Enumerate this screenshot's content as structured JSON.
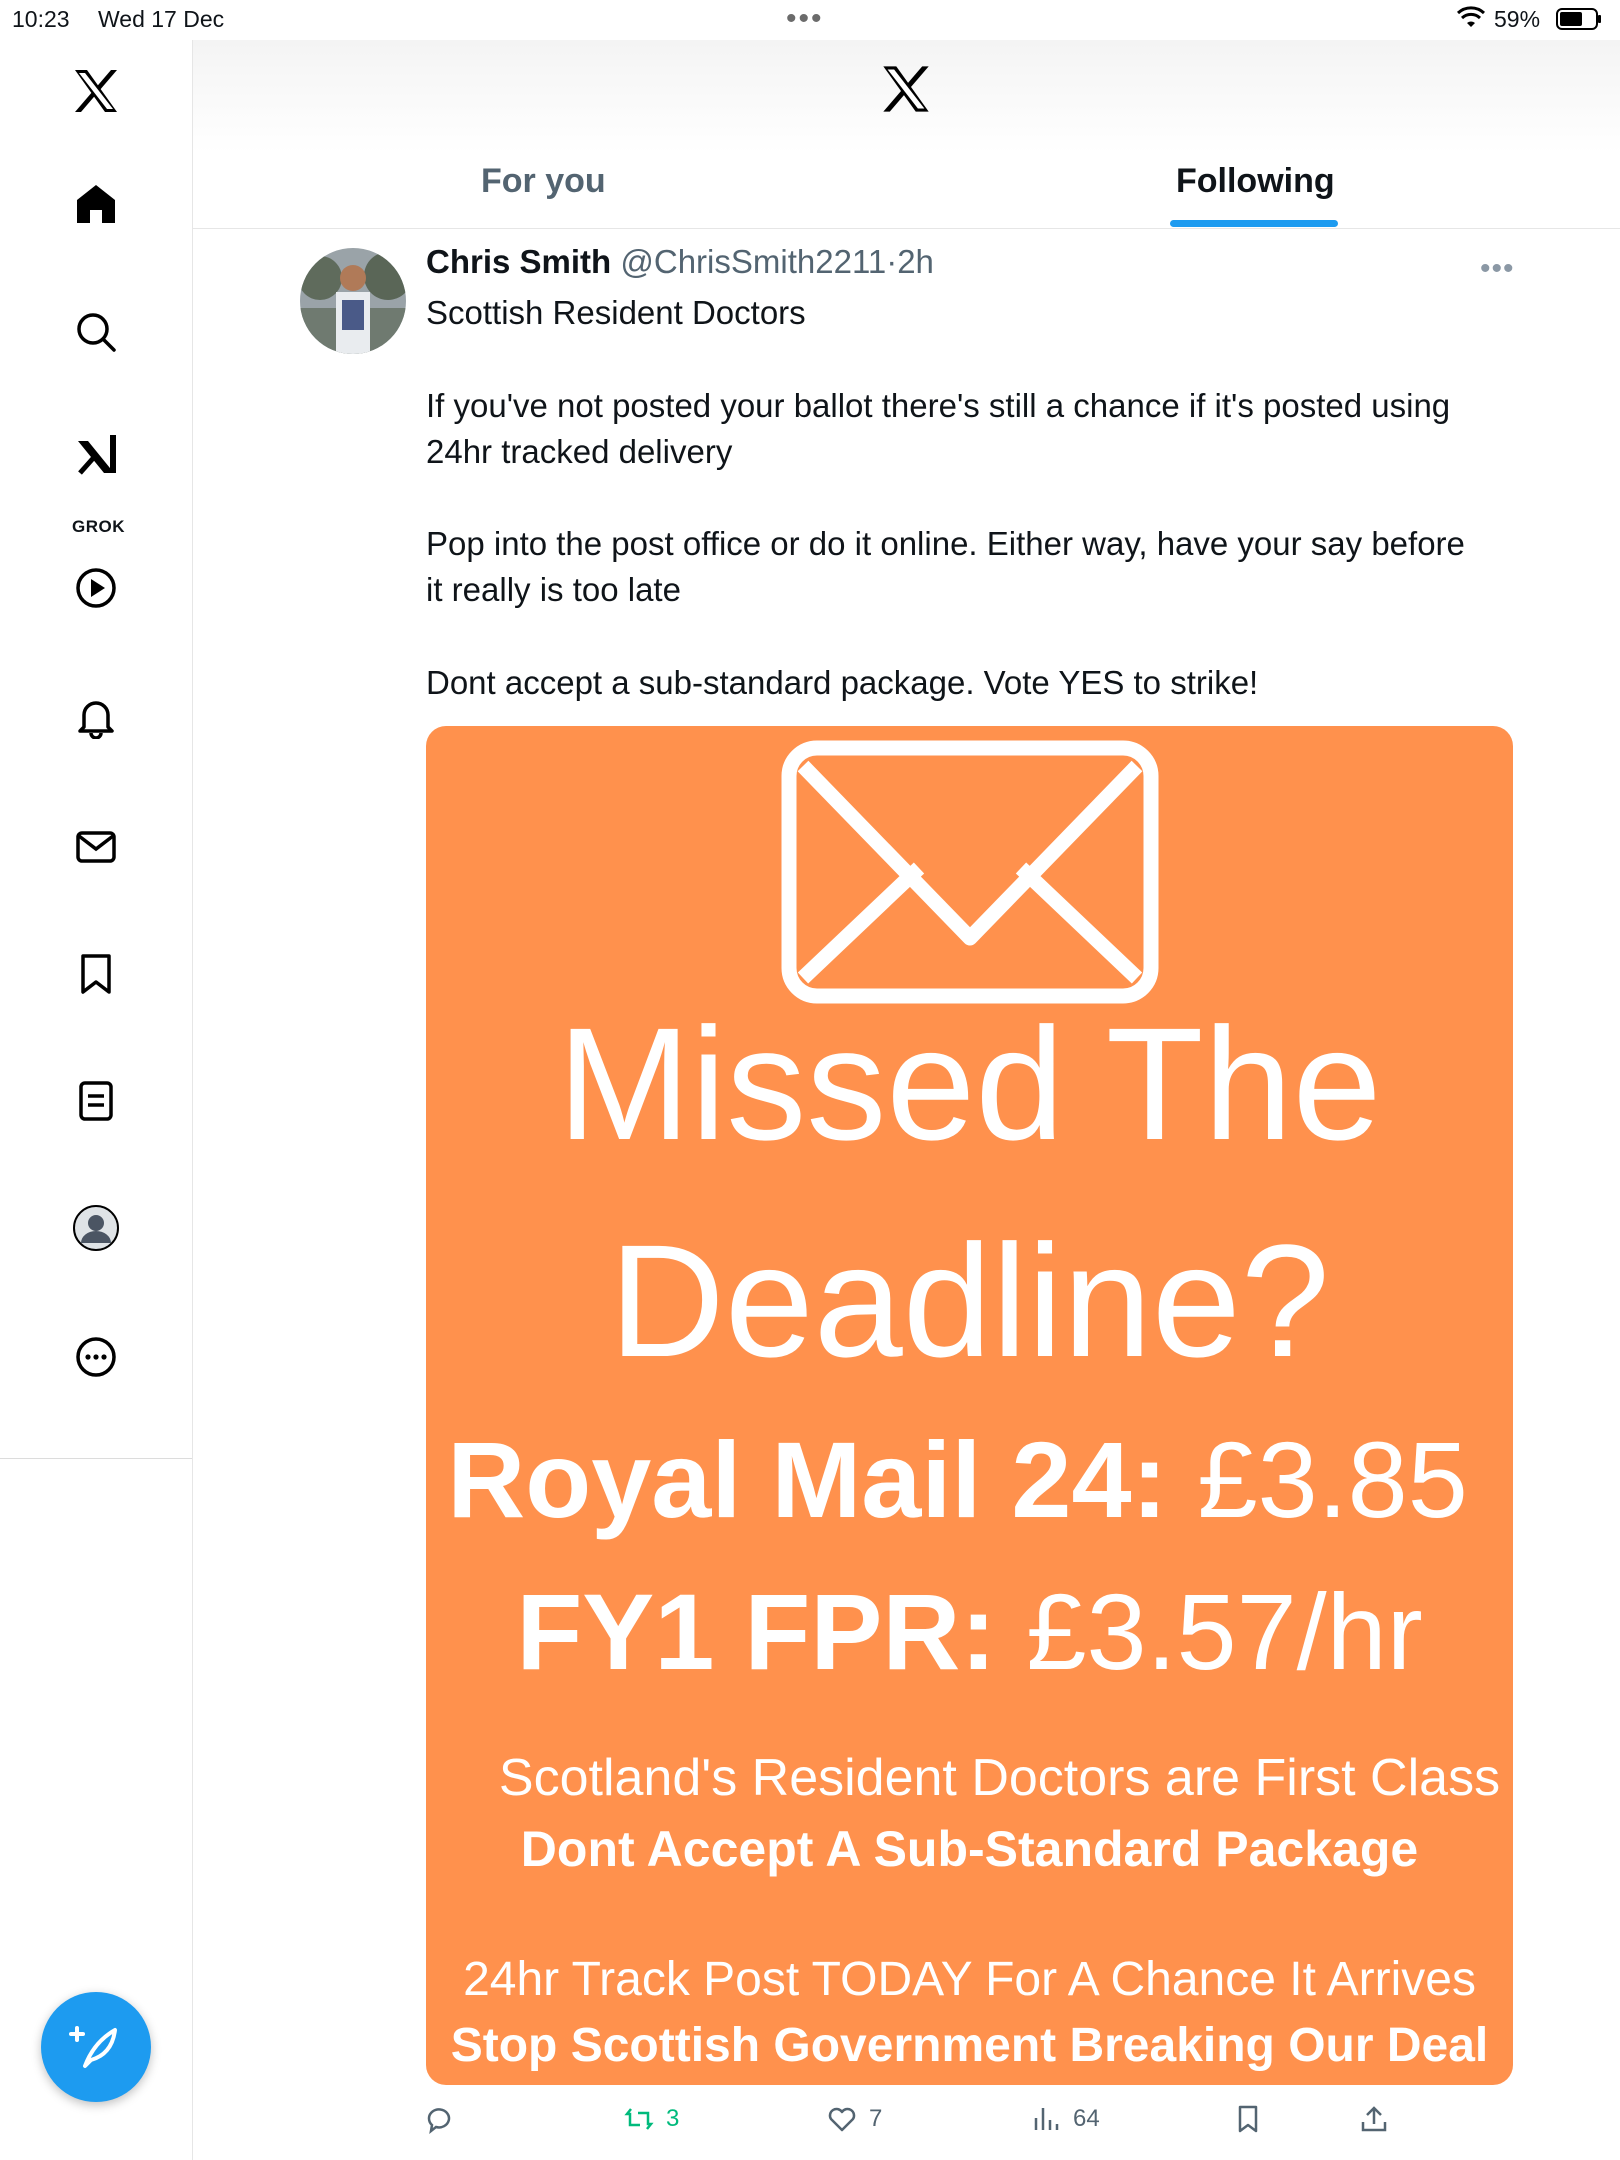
{
  "status_bar": {
    "time": "10:23",
    "date": "Wed 17 Dec",
    "battery": "59%"
  },
  "sidebar": {
    "items": [
      {
        "name": "x-logo-icon"
      },
      {
        "name": "home-icon"
      },
      {
        "name": "search-icon"
      },
      {
        "name": "grok-icon",
        "label": "GROK"
      },
      {
        "name": "video-icon"
      },
      {
        "name": "notifications-icon"
      },
      {
        "name": "messages-icon"
      },
      {
        "name": "bookmarks-icon"
      },
      {
        "name": "lists-icon"
      },
      {
        "name": "profile-icon"
      },
      {
        "name": "more-icon"
      }
    ]
  },
  "tabs": [
    {
      "label": "For you",
      "active": false
    },
    {
      "label": "Following",
      "active": true
    }
  ],
  "tweet": {
    "author_name": "Chris Smith",
    "author_handle": "@ChrisSmith2211",
    "separator": "·",
    "time": "2h",
    "lines": [
      "Scottish Resident Doctors",
      "If you've not posted your ballot there's still a chance if it's posted using",
      "24hr tracked delivery",
      "Pop into the post office or do it online. Either way, have your say before",
      "it really is too late",
      "Dont accept a sub-standard package. Vote YES to strike!"
    ],
    "media": {
      "background": "#ff914d",
      "title_line1": "Missed The",
      "title_line2": "Deadline?",
      "price1_label": "Royal Mail 24:",
      "price1_value": "£3.85",
      "price2_label": "FY1 FPR:",
      "price2_value": "£3.57/hr",
      "sub1": "Scotland's Resident Doctors are First Class",
      "sub2": "Dont Accept A Sub-Standard Package",
      "sub3": "24hr Track Post TODAY For A Chance It Arrives",
      "sub4": "Stop Scottish Government Breaking Our Deal"
    },
    "actions": {
      "reposts": "3",
      "likes": "7",
      "views": "64"
    }
  },
  "colors": {
    "accent": "#1d9bf0",
    "repost": "#00ba7c",
    "media_bg": "#ff914d"
  }
}
